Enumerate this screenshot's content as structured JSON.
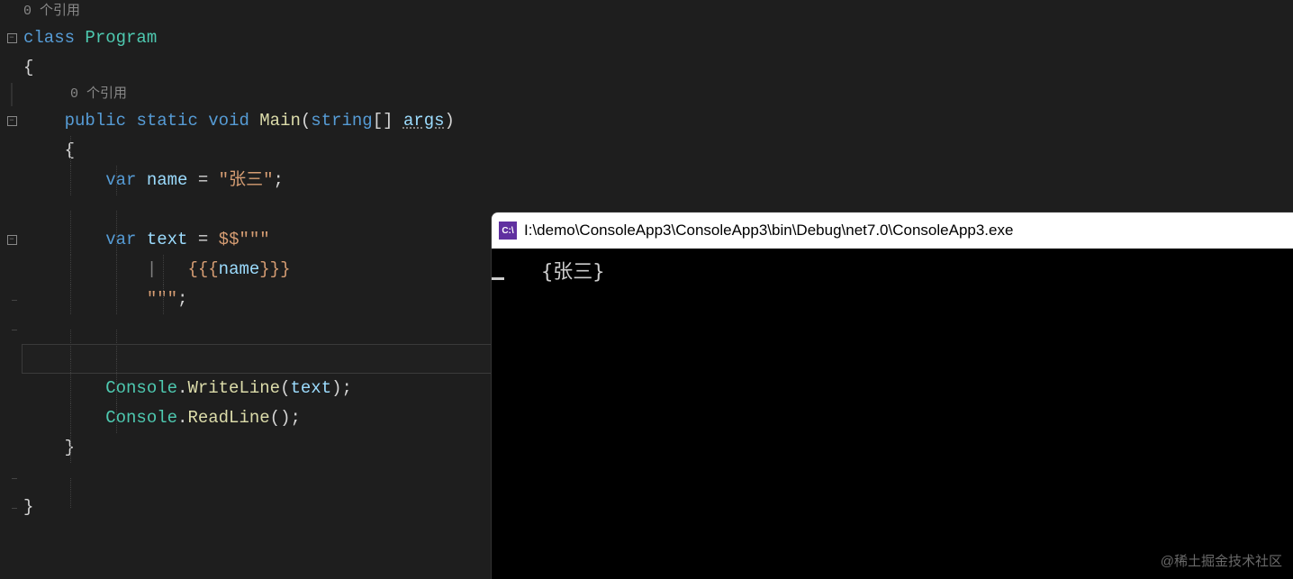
{
  "codelens": {
    "class_refs": "0 个引用",
    "method_refs": "0 个引用"
  },
  "code": {
    "kw_class": "class",
    "class_name": "Program",
    "kw_public": "public",
    "kw_static": "static",
    "kw_void": "void",
    "method_name": "Main",
    "param_type": "string",
    "brackets": "[]",
    "param_name": "args",
    "kw_var1": "var",
    "var_name1": "name",
    "assign1": " = ",
    "string1": "\"张三\"",
    "semi": ";",
    "kw_var2": "var",
    "var_name2": "text",
    "assign2": " = ",
    "raw_prefix": "$$",
    "raw_open": "\"\"\"",
    "pipe": "|",
    "raw_content_braces_open": "{{{",
    "raw_content_var": "name",
    "raw_content_braces_close": "}}}",
    "raw_close": "\"\"\"",
    "console_class": "Console",
    "dot": ".",
    "writeline": "WriteLine",
    "readline": "ReadLine",
    "text_arg": "text",
    "paren_open": "(",
    "paren_close": ")",
    "brace_open": "{",
    "brace_close": "}"
  },
  "console": {
    "icon_text": "C:\\",
    "title": "I:\\demo\\ConsoleApp3\\ConsoleApp3\\bin\\Debug\\net7.0\\ConsoleApp3.exe",
    "output": "{张三}"
  },
  "watermark": "@稀土掘金技术社区"
}
